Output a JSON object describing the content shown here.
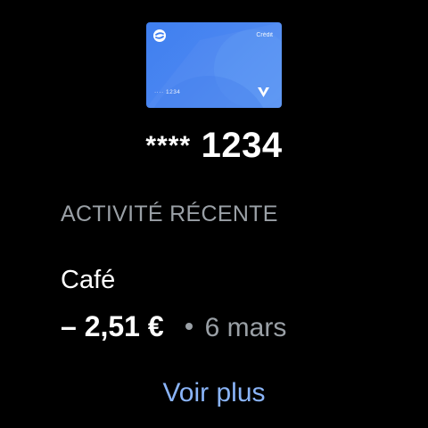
{
  "card": {
    "type_label": "Crédit",
    "masked_short": "···· 1234",
    "logo_icon": "wallet-logo-icon",
    "brand_icon": "card-network-v-icon",
    "colors": {
      "start": "#3f7ff0",
      "end": "#5a94f3"
    }
  },
  "card_number": {
    "stars": "****",
    "last4": "1234"
  },
  "activity": {
    "title": "ACTIVITÉ RÉCENTE",
    "items": [
      {
        "merchant": "Café",
        "amount": "– 2,51 €",
        "date": "6 mars"
      }
    ]
  },
  "more_label": "Voir plus",
  "colors": {
    "background": "#000000",
    "secondary_text": "#9aa0a6",
    "link": "#8ab4f8"
  }
}
